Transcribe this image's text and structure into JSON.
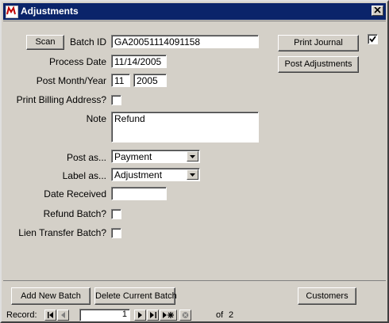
{
  "window": {
    "title": "Adjustments"
  },
  "form": {
    "scan_label": "Scan",
    "batch_id_label": "Batch ID",
    "batch_id_value": "GA20051114091158",
    "process_date_label": "Process Date",
    "process_date_value": "11/14/2005",
    "post_month_year_label": "Post Month/Year",
    "post_month_value": "11",
    "post_year_value": "2005",
    "print_billing_label": "Print Billing Address?",
    "print_billing_checked": false,
    "note_label": "Note",
    "note_value": "Refund",
    "post_as_label": "Post as...",
    "post_as_value": "Payment",
    "label_as_label": "Label as...",
    "label_as_value": "Adjustment",
    "date_received_label": "Date Received",
    "date_received_value": "",
    "refund_batch_label": "Refund Batch?",
    "refund_batch_checked": false,
    "lien_transfer_label": "Lien Transfer Batch?",
    "lien_transfer_checked": false,
    "print_journal_label": "Print Journal",
    "print_journal_checked": true,
    "post_adjustments_label": "Post Adjustments"
  },
  "footer": {
    "add_new_batch_label": "Add New Batch",
    "delete_batch_label": "Delete Current Batch",
    "customers_label": "Customers"
  },
  "record_nav": {
    "label": "Record:",
    "current": "1",
    "of_text": "of",
    "total": "2"
  },
  "colors": {
    "titlebar": "#0a246a",
    "face": "#d4d0c8"
  },
  "icons": [
    "app-icon",
    "close-icon",
    "dropdown-arrow-icon",
    "first-record-icon",
    "prev-record-icon",
    "next-record-icon",
    "last-record-icon",
    "new-record-icon",
    "delete-record-icon",
    "checkmark-icon"
  ]
}
